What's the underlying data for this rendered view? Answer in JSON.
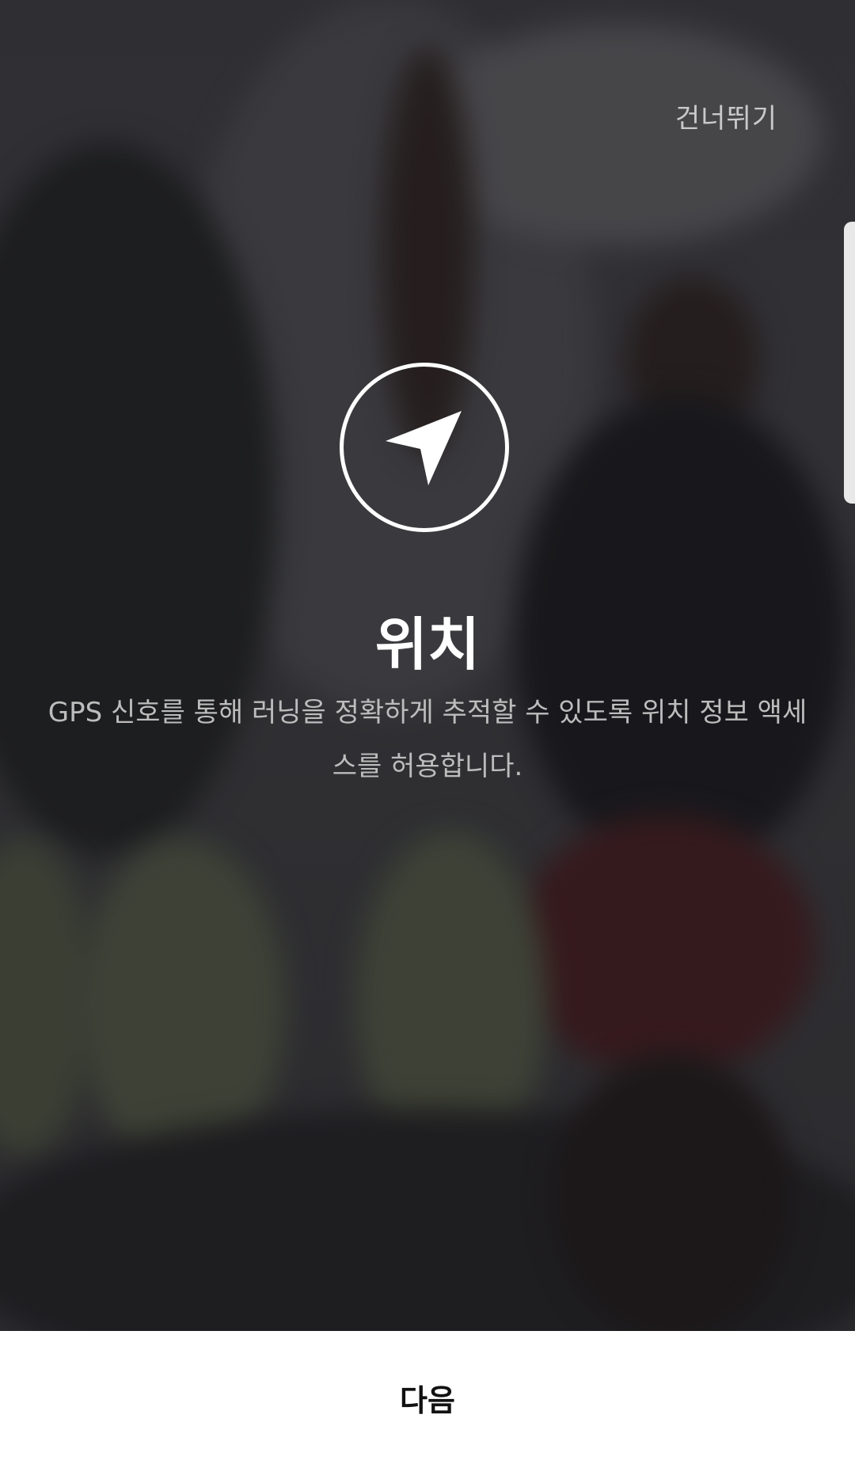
{
  "header": {
    "skip_label": "건너뛰기"
  },
  "main": {
    "icon": "location-arrow-icon",
    "title": "위치",
    "description": "GPS 신호를 통해 러닝을 정확하게 추적할 수 있도록 위치 정보 액세스를 허용합니다."
  },
  "footer": {
    "next_label": "다음"
  },
  "colors": {
    "text_primary": "#ffffff",
    "text_secondary": "#bdbdbd",
    "bottom_bar": "#ffffff",
    "button_text": "#111111"
  }
}
